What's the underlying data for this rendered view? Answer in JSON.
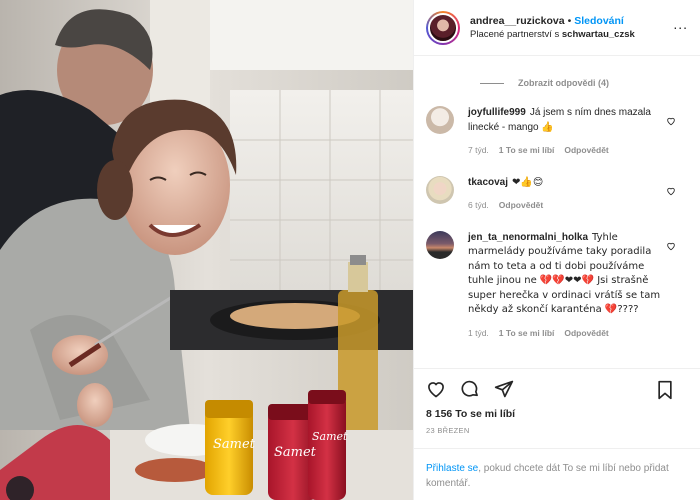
{
  "post": {
    "username": "andrea__ruzickova",
    "dot": "•",
    "follow_label": "Sledování",
    "paid_prefix": "Placené partnerství s ",
    "partner": "schwartau_czsk",
    "more_label": "..."
  },
  "comments_area": {
    "view_replies": "Zobrazit odpovědi (4)",
    "items": [
      {
        "user": "joyfullife999",
        "text": "Já jsem s ním dnes mazala linecké - mango 👍",
        "time": "7 týd.",
        "likes": "1 To se mi líbí",
        "reply": "Odpovědět"
      },
      {
        "user": "tkacovaj",
        "text": "❤👍😊",
        "time": "6 týd.",
        "likes": "",
        "reply": "Odpovědět"
      },
      {
        "user": "jen_ta_nenormalni_holka",
        "text": "Tyhle marmelády používáme taky poradila nám to teta a od ti dobi používáme tuhle jinou ne 💔💔❤❤💔 Jsi strašně super herečka v ordinaci vrátíš se tam někdy až skončí karanténa 💔????",
        "time": "1 týd.",
        "likes": "1 To se mi líbí",
        "reply": "Odpovědět"
      }
    ]
  },
  "actions": {
    "like_icon": "heart-icon",
    "comment_icon": "comment-icon",
    "share_icon": "share-icon",
    "save_icon": "bookmark-icon"
  },
  "likes_count": "8 156 To se mi líbí",
  "date": "23 BŘEZEN",
  "login": {
    "link": "Přihlaste se",
    "text": ", pokud chcete dát To se mi líbí nebo přidat komentář."
  },
  "product": {
    "brand": "Schwartau",
    "name": "Samet"
  },
  "colors": {
    "accent": "#0095f6",
    "text": "#262626",
    "muted": "#8e8e8e",
    "heart": "#e0245e"
  }
}
